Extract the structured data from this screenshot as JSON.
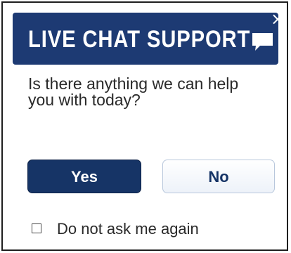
{
  "dialog": {
    "title": "LIVE CHAT SUPPORT",
    "chat_icon": "speech-bubble-icon",
    "close_icon": "close-icon",
    "close_symbol": "×",
    "question": "Is there anything we can help you with today?",
    "buttons": {
      "yes_label": "Yes",
      "no_label": "No"
    },
    "checkbox": {
      "label": "Do not ask me again",
      "checked": false
    }
  },
  "colors": {
    "header_background": "#1d3a73",
    "yes_button_background": "#163466",
    "no_button_text": "#163466"
  }
}
